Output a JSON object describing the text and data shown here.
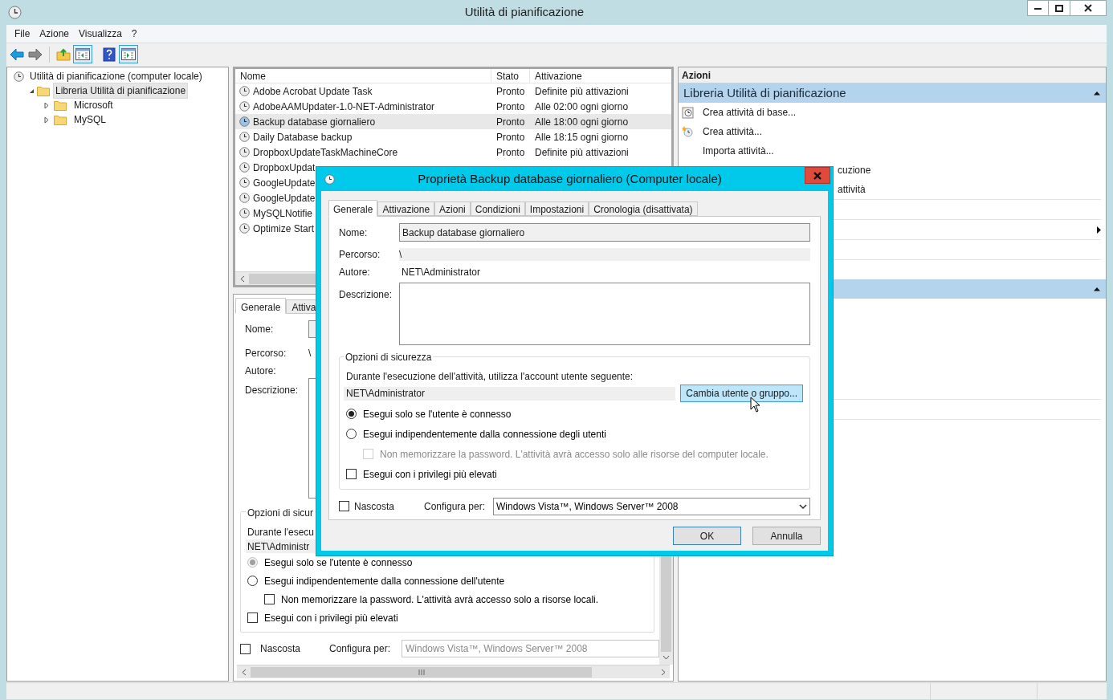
{
  "window": {
    "title": "Utilità di pianificazione"
  },
  "menu": [
    "File",
    "Azione",
    "Visualizza",
    "?"
  ],
  "toolbar": [
    {
      "kind": "back"
    },
    {
      "kind": "forward"
    },
    {
      "kind": "up"
    },
    {
      "kind": "tree-pane",
      "on": true
    },
    {
      "kind": "help"
    },
    {
      "kind": "action-pane",
      "on": true
    }
  ],
  "tree": [
    {
      "label": "Utilità di pianificazione (computer locale)",
      "selected": false,
      "children": [
        {
          "label": "Libreria Utilità di pianificazione",
          "expanded": true,
          "selected": true,
          "children": [
            {
              "label": "Microsoft",
              "expanded": false,
              "selected": false
            },
            {
              "label": "MySQL",
              "expanded": false,
              "selected": false
            }
          ]
        }
      ]
    }
  ],
  "tasks": {
    "columns": [
      "Nome",
      "Stato",
      "Attivazione"
    ],
    "rows": [
      {
        "name": "Adobe Acrobat Update Task",
        "status": "Pronto",
        "trigger": "Definite più attivazioni",
        "selected": false
      },
      {
        "name": "AdobeAAMUpdater-1.0-NET-Administrator",
        "status": "Pronto",
        "trigger": "Alle 02:00 ogni giorno",
        "selected": false
      },
      {
        "name": "Backup database giornaliero",
        "status": "Pronto",
        "trigger": "Alle 18:00 ogni giorno",
        "selected": true
      },
      {
        "name": "Daily Database backup",
        "status": "Pronto",
        "trigger": "Alle 18:15 ogni giorno",
        "selected": false
      },
      {
        "name": "DropboxUpdateTaskMachineCore",
        "status": "Pronto",
        "trigger": "Definite più attivazioni",
        "selected": false
      },
      {
        "name": "DropboxUpdat",
        "selected": false
      },
      {
        "name": "GoogleUpdate",
        "selected": false
      },
      {
        "name": "GoogleUpdate",
        "selected": false
      },
      {
        "name": "MySQLNotifie",
        "selected": false
      },
      {
        "name": "Optimize Start",
        "selected": false
      }
    ]
  },
  "details": {
    "tabs": [
      {
        "label": "Generale",
        "selected": true
      },
      {
        "label": "Attiva",
        "selected": false
      }
    ],
    "name_label": "Nome:",
    "path_label": "Percorso:",
    "path": "\\",
    "author_label": "Autore:",
    "description_label": "Descrizione:",
    "security": {
      "title": "Opzioni di sicur",
      "account_label": "Durante l'esecu",
      "account": "NET\\Administr",
      "options": [
        {
          "kind": "radio",
          "label": "Esegui solo se l'utente è connesso",
          "selected": true,
          "disabled": true
        },
        {
          "kind": "radio",
          "label": "Esegui indipendentemente dalla connessione dell'utente",
          "selected": false,
          "disabled": false,
          "children": [
            {
              "kind": "checkbox",
              "label": "Non memorizzare la password. L'attività avrà accesso solo a risorse locali.",
              "checked": false,
              "disabled": false
            }
          ]
        },
        {
          "kind": "checkbox",
          "label": "Esegui con i privilegi più elevati",
          "checked": false,
          "disabled": false
        }
      ]
    },
    "hidden": {
      "label": "Nascosta",
      "checked": false
    },
    "configure": {
      "label": "Configura per:",
      "value": "Windows Vista™, Windows Server™ 2008",
      "disabled": true
    }
  },
  "actions": {
    "title": "Azioni",
    "sections": [
      {
        "title": "Libreria Utilità di pianificazione",
        "expanded": true,
        "items": [
          {
            "kind": "basic-task",
            "label": "Crea attività di base..."
          },
          {
            "kind": "task",
            "label": "Crea attività..."
          },
          {
            "kind": "plain",
            "label": "Importa attività..."
          },
          {
            "kind": "cut",
            "label": "cuzione"
          },
          {
            "kind": "cut",
            "label": "attività"
          },
          {
            "kind": "blank",
            "separator": true
          },
          {
            "kind": "submenu",
            "separator": true
          },
          {
            "kind": "blank",
            "separator": true
          },
          {
            "kind": "blank",
            "separator": true
          }
        ]
      },
      {
        "expanded": true,
        "items": [
          {
            "kind": "blank",
            "separator": false
          },
          {
            "kind": "blank",
            "separator": false
          },
          {
            "kind": "blank",
            "separator": false
          },
          {
            "kind": "blank",
            "separator": false
          },
          {
            "kind": "blank",
            "separator": false
          },
          {
            "kind": "blank",
            "separator": true
          },
          {
            "kind": "blank",
            "separator": true
          }
        ]
      }
    ]
  },
  "dialog": {
    "title": "Proprietà Backup database giornaliero (Computer locale)",
    "tabs": [
      {
        "label": "Generale",
        "selected": true
      },
      {
        "label": "Attivazione",
        "selected": false
      },
      {
        "label": "Azioni",
        "selected": false
      },
      {
        "label": "Condizioni",
        "selected": false
      },
      {
        "label": "Impostazioni",
        "selected": false
      },
      {
        "label": "Cronologia (disattivata)",
        "selected": false
      }
    ],
    "name_label": "Nome:",
    "name": "Backup database giornaliero",
    "path_label": "Percorso:",
    "path": "\\",
    "author_label": "Autore:",
    "author": "NET\\Administrator",
    "description_label": "Descrizione:",
    "security": {
      "title": "Opzioni di sicurezza",
      "account_label": "Durante l'esecuzione dell'attività, utilizza l'account utente seguente:",
      "account": "NET\\Administrator",
      "change_button": "Cambia utente o gruppo...",
      "options": [
        {
          "kind": "radio",
          "label": "Esegui solo se l'utente è connesso",
          "selected": true,
          "disabled": false
        },
        {
          "kind": "radio",
          "label": "Esegui indipendentemente dalla connessione degli utenti",
          "selected": false,
          "disabled": false,
          "children": [
            {
              "kind": "checkbox",
              "label": "Non memorizzare la password. L'attività avrà accesso solo alle risorse del computer locale.",
              "checked": false,
              "disabled": true
            }
          ]
        },
        {
          "kind": "checkbox",
          "label": "Esegui con i privilegi più elevati",
          "checked": false,
          "disabled": false
        }
      ]
    },
    "hidden": {
      "label": "Nascosta",
      "checked": false
    },
    "configure": {
      "label": "Configura per:",
      "value": "Windows Vista™, Windows Server™ 2008",
      "disabled": false
    },
    "buttons": [
      "OK",
      "Annulla"
    ]
  }
}
